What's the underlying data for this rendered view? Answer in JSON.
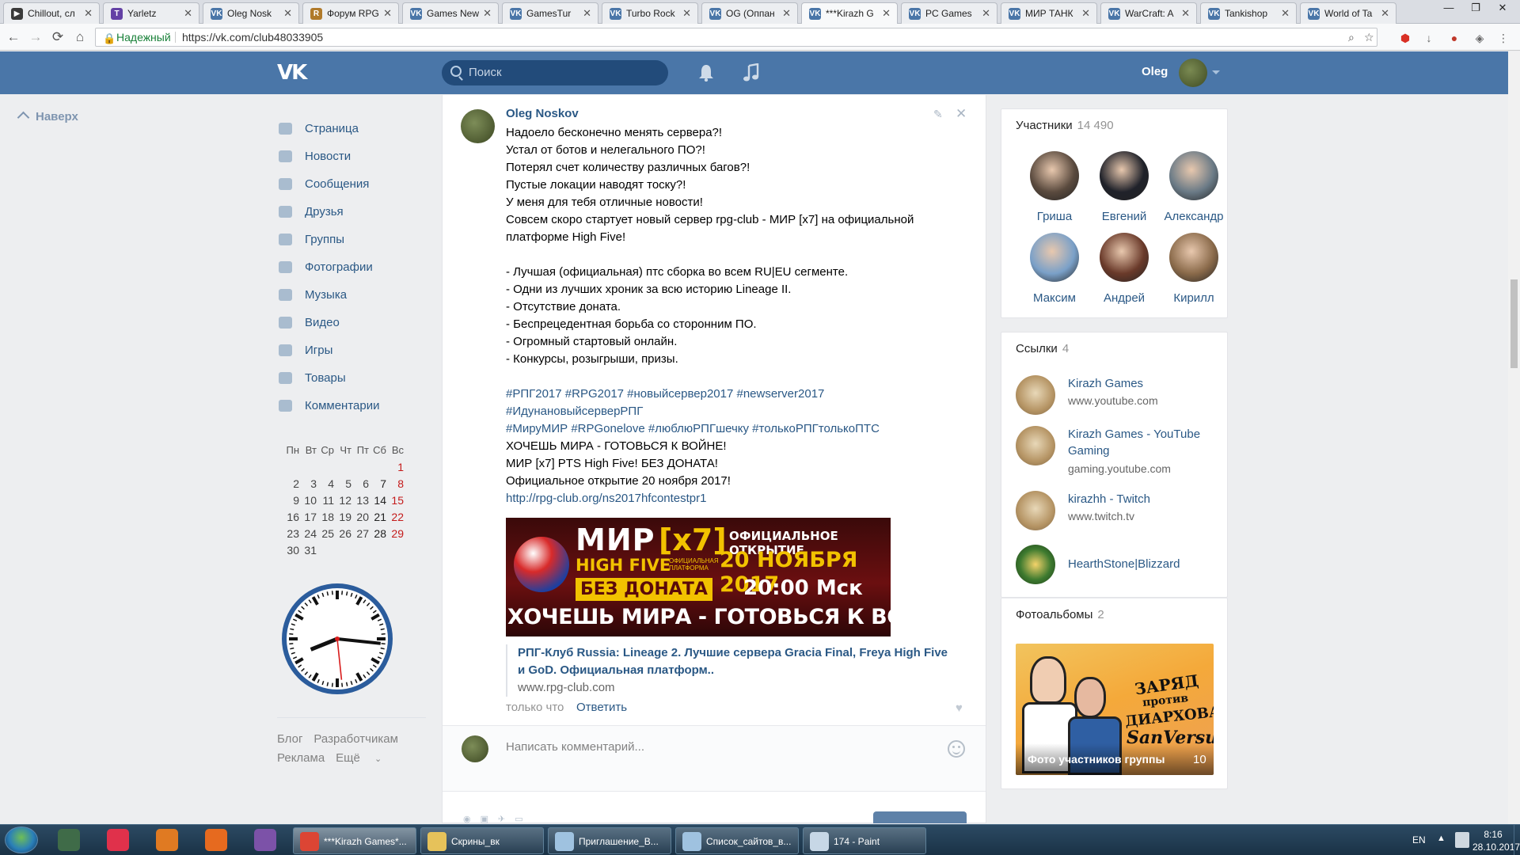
{
  "browser": {
    "tabs": [
      {
        "label": "Chillout, сл",
        "color": "#3a3a3a",
        "glyph": "▶"
      },
      {
        "label": "Yarletz",
        "color": "#6441a5",
        "glyph": "T"
      },
      {
        "label": "Oleg Nosk",
        "color": "#4a76a8",
        "glyph": "VK"
      },
      {
        "label": "Форум RPG",
        "color": "#b07a2a",
        "glyph": "R"
      },
      {
        "label": "Games New",
        "color": "#4a76a8",
        "glyph": "VK"
      },
      {
        "label": "GamesTur",
        "color": "#4a76a8",
        "glyph": "VK"
      },
      {
        "label": "Turbo Rock",
        "color": "#4a76a8",
        "glyph": "VK"
      },
      {
        "label": "OG (Оппан",
        "color": "#4a76a8",
        "glyph": "VK"
      },
      {
        "label": "***Kirazh G",
        "color": "#4a76a8",
        "glyph": "VK"
      },
      {
        "label": "PC Games",
        "color": "#4a76a8",
        "glyph": "VK"
      },
      {
        "label": "МИР ТАНК",
        "color": "#4a76a8",
        "glyph": "VK"
      },
      {
        "label": "WarCraft: A",
        "color": "#4a76a8",
        "glyph": "VK"
      },
      {
        "label": "Tankishop",
        "color": "#4a76a8",
        "glyph": "VK"
      },
      {
        "label": "World of Ta",
        "color": "#4a76a8",
        "glyph": "VK"
      }
    ],
    "active_tab": 8,
    "secure_label": "Надежный",
    "url": "https://vk.com/club48033905",
    "window_controls": [
      "—",
      "❐",
      "✕"
    ]
  },
  "header": {
    "logo": "VK",
    "search_placeholder": "Поиск",
    "user_name": "Oleg"
  },
  "left": {
    "up_label": "Наверх",
    "menu": [
      {
        "label": "Страница",
        "icon": "home-icon"
      },
      {
        "label": "Новости",
        "icon": "news-icon"
      },
      {
        "label": "Сообщения",
        "icon": "messages-icon"
      },
      {
        "label": "Друзья",
        "icon": "friends-icon"
      },
      {
        "label": "Группы",
        "icon": "groups-icon"
      },
      {
        "label": "Фотографии",
        "icon": "camera-icon"
      },
      {
        "label": "Музыка",
        "icon": "music-icon"
      },
      {
        "label": "Видео",
        "icon": "video-icon"
      },
      {
        "label": "Игры",
        "icon": "gamepad-icon"
      },
      {
        "label": "Товары",
        "icon": "bag-icon"
      },
      {
        "label": "Комментарии",
        "icon": "comment-icon"
      }
    ],
    "calendar": {
      "weekdays": [
        "Пн",
        "Вт",
        "Ср",
        "Чт",
        "Пт",
        "Сб",
        "Вс"
      ],
      "weeks": [
        [
          "",
          "",
          "",
          "",
          "",
          "",
          "1"
        ],
        [
          "2",
          "3",
          "4",
          "5",
          "6",
          "7",
          "8"
        ],
        [
          "9",
          "10",
          "11",
          "12",
          "13",
          "14",
          "15"
        ],
        [
          "16",
          "17",
          "18",
          "19",
          "20",
          "21",
          "22"
        ],
        [
          "23",
          "24",
          "25",
          "26",
          "27",
          "28",
          "29"
        ],
        [
          "30",
          "31",
          "",
          "",
          "",
          "",
          ""
        ]
      ]
    },
    "clock": {
      "hour": 8,
      "minute": 16,
      "second": 29
    },
    "footer": [
      "Блог",
      "Разработчикам",
      "Реклама",
      "Ещё"
    ]
  },
  "post": {
    "author": "Oleg Noskov",
    "lines": [
      {
        "text": "Надоело бесконечно менять сервера?!",
        "kind": "text"
      },
      {
        "text": "Устал от ботов и нелегального ПО?!",
        "kind": "text"
      },
      {
        "text": "Потерял счет количеству различных багов?!",
        "kind": "text"
      },
      {
        "text": "Пустые локации наводят тоску?!",
        "kind": "text"
      },
      {
        "text": "У меня для тебя отличные новости!",
        "kind": "text"
      },
      {
        "text": "Совсем скоро стартует новый сервер rpg-club - МИР [x7] на официальной",
        "kind": "text"
      },
      {
        "text": "платформе High Five!",
        "kind": "text"
      },
      {
        "text": "",
        "kind": "text"
      },
      {
        "text": "- Лучшая (официальная) птс сборка во всем RU|EU сегменте.",
        "kind": "text"
      },
      {
        "text": "- Одни из лучших хроник за всю историю Lineage II.",
        "kind": "text"
      },
      {
        "text": "- Отсутствие доната.",
        "kind": "text"
      },
      {
        "text": "- Беспрецедентная борьба со сторонним ПО.",
        "kind": "text"
      },
      {
        "text": "- Огромный стартовый онлайн.",
        "kind": "text"
      },
      {
        "text": "- Конкурсы, розыгрыши, призы.",
        "kind": "text"
      },
      {
        "text": "",
        "kind": "text"
      },
      {
        "text": "#РПГ2017 #RPG2017 #новыйсервер2017 #newserver2017",
        "kind": "tag"
      },
      {
        "text": "#ИдунановыйсерверРПГ",
        "kind": "tag"
      },
      {
        "text": "#МируМИР #RPGonelove #люблюРПГшечку #толькоРПГтолькоПТС",
        "kind": "tag"
      },
      {
        "text": "ХОЧЕШЬ МИРА - ГОТОВЬСЯ К ВОЙНЕ!",
        "kind": "text"
      },
      {
        "text": "МИР [x7] PTS High Five! БЕЗ ДОНАТА!",
        "kind": "text"
      },
      {
        "text": "Официальное открытие 20 ноября 2017!",
        "kind": "text"
      },
      {
        "text": "http://rpg-club.org/ns2017hfcontestpr1",
        "kind": "link"
      }
    ],
    "banner": {
      "mir": "МИР",
      "x7": "[x7]",
      "high_five": "HIGH FIVE",
      "platform": "ОФИЦИАЛЬНАЯ ПЛАТФОРМА",
      "no_donate": "БЕЗ ДОНАТА",
      "opening": "ОФИЦИАЛЬНОЕ ОТКРЫТИЕ",
      "date": "20 НОЯБРЯ 2017",
      "time": "20:00 Мск",
      "slogan": "ХОЧЕШЬ МИРА - ГОТОВЬСЯ К ВОЙНЕ"
    },
    "attachment": {
      "title": "РПГ-Клуб Russia: Lineage 2. Лучшие сервера Gracia Final, Freya High Five и GoD. Официальная платформ..",
      "domain": "www.rpg-club.com"
    },
    "time": "только что",
    "reply_label": "Ответить",
    "comment_placeholder": "Написать комментарий..."
  },
  "members": {
    "title": "Участники",
    "count": "14 490",
    "people": [
      {
        "name": "Гриша",
        "color": "#5a4a3e"
      },
      {
        "name": "Евгений",
        "color": "#20222a"
      },
      {
        "name": "Александр",
        "color": "#6a7a86"
      },
      {
        "name": "Максим",
        "color": "#7aa0c8"
      },
      {
        "name": "Андрей",
        "color": "#6a3a2a"
      },
      {
        "name": "Кирилл",
        "color": "#8a6a4a"
      }
    ]
  },
  "links": {
    "title": "Ссылки",
    "count": "4",
    "items": [
      {
        "title": "Kirazh Games",
        "domain": "www.youtube.com"
      },
      {
        "title": "Kirazh Games - YouTube Gaming",
        "domain": "gaming.youtube.com"
      },
      {
        "title": "kirazhh - Twitch",
        "domain": "www.twitch.tv"
      },
      {
        "title": "HearthStone|Blizzard",
        "domain": ""
      }
    ]
  },
  "albums": {
    "title": "Фотоальбомы",
    "count": "2",
    "cover": {
      "name": "Фото участников группы",
      "count": "10",
      "art_text": [
        "ЗАРЯД",
        "против",
        "ДИАРХОВА",
        "SanVersus"
      ]
    }
  },
  "taskbar": {
    "pinned": [
      {
        "name": "explorer-pin-icon",
        "color": "#3f6b48"
      },
      {
        "name": "itunes-pin-icon",
        "color": "#e0314b"
      },
      {
        "name": "media-player-pin-icon",
        "color": "#e07a22"
      },
      {
        "name": "firefox-pin-icon",
        "color": "#e66a1f"
      },
      {
        "name": "viber-pin-icon",
        "color": "#7c52a8"
      }
    ],
    "tasks": [
      {
        "label": "***Kirazh Games*...",
        "color": "#dc4534",
        "active": true
      },
      {
        "label": "Скрины_вк",
        "color": "#e6c25a",
        "active": false
      },
      {
        "label": "Приглашение_В...",
        "color": "#9fc2e0",
        "active": false
      },
      {
        "label": "Список_сайтов_в...",
        "color": "#9fc2e0",
        "active": false
      },
      {
        "label": "174 - Paint",
        "color": "#c7d7e6",
        "active": false
      }
    ],
    "lang": "EN",
    "time": "8:16",
    "date": "28.10.2017"
  }
}
